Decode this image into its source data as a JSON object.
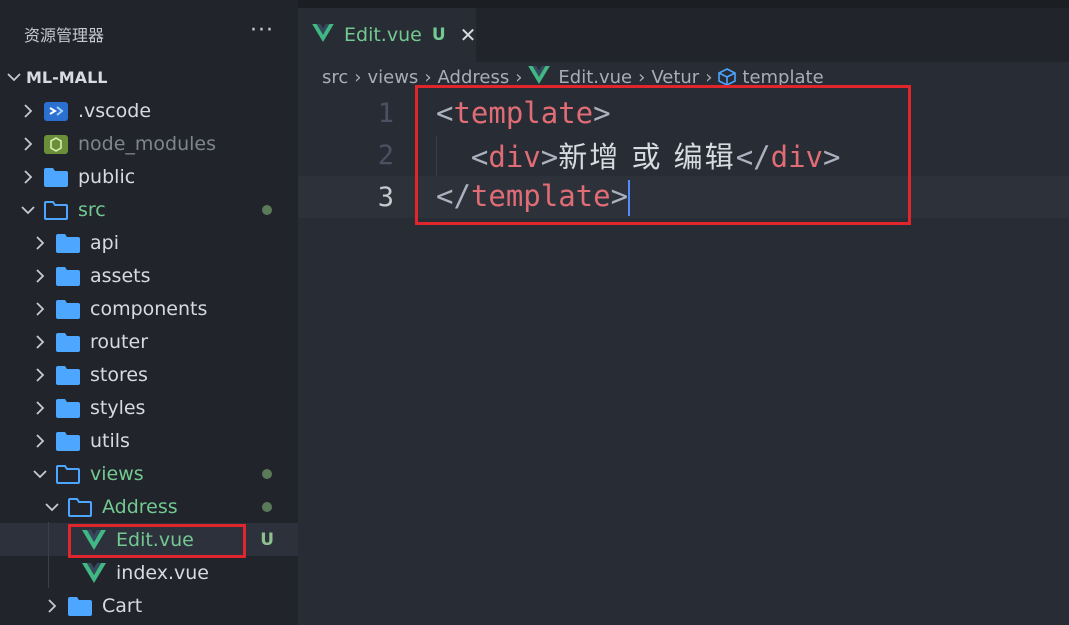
{
  "sidebar": {
    "title": "资源管理器",
    "more_icon": "···",
    "root": "ML-MALL",
    "items": [
      {
        "label": ".vscode"
      },
      {
        "label": "node_modules"
      },
      {
        "label": "public"
      },
      {
        "label": "src"
      },
      {
        "label": "api"
      },
      {
        "label": "assets"
      },
      {
        "label": "components"
      },
      {
        "label": "router"
      },
      {
        "label": "stores"
      },
      {
        "label": "styles"
      },
      {
        "label": "utils"
      },
      {
        "label": "views"
      },
      {
        "label": "Address"
      },
      {
        "label": "Edit.vue",
        "badge": "U"
      },
      {
        "label": "index.vue"
      },
      {
        "label": "Cart"
      }
    ]
  },
  "tab": {
    "label": "Edit.vue",
    "status": "U",
    "close": "✕"
  },
  "breadcrumb": [
    "src",
    "views",
    "Address",
    "Edit.vue",
    "Vetur",
    "template"
  ],
  "code": {
    "line_numbers": [
      "1",
      "2",
      "3"
    ],
    "line1_tag": "template",
    "line2_tag_open": "div",
    "line2_text": "新增 或 编辑",
    "line2_tag_close": "div",
    "line3_tag": "template"
  },
  "colors": {
    "accent_red": "#e0262c",
    "git_green": "#73c991",
    "vue_green": "#41b883",
    "folder_blue": "#4da6ff"
  }
}
